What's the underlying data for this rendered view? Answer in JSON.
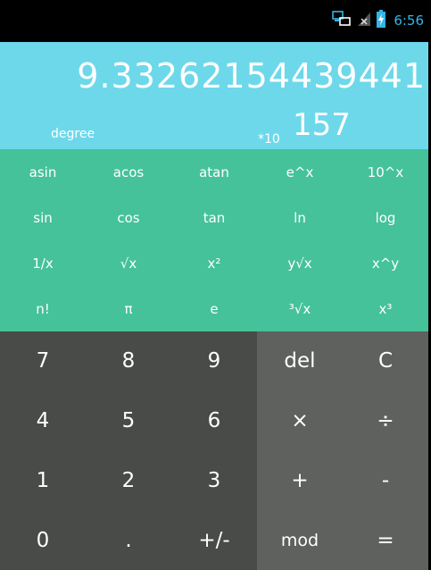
{
  "status_bar": {
    "time": "6:56",
    "icons": [
      "network-icon",
      "signal-icon",
      "battery-charging-icon"
    ],
    "accent_color": "#33b5e5"
  },
  "display": {
    "value": "9.33262154439441",
    "mode": "degree",
    "exponent_base": "*10",
    "exponent": "157",
    "background": "#6dd8ea"
  },
  "scientific_keys": [
    [
      "asin",
      "acos",
      "atan",
      "e^x",
      "10^x"
    ],
    [
      "sin",
      "cos",
      "tan",
      "ln",
      "log"
    ],
    [
      "1/x",
      "√x",
      "x²",
      "y√x",
      "x^y"
    ],
    [
      "n!",
      "π",
      "e",
      "³√x",
      "x³"
    ]
  ],
  "number_keys": [
    [
      "7",
      "8",
      "9"
    ],
    [
      "4",
      "5",
      "6"
    ],
    [
      "1",
      "2",
      "3"
    ],
    [
      "0",
      ".",
      "+/-"
    ]
  ],
  "operator_keys": [
    [
      "del",
      "C"
    ],
    [
      "×",
      "÷"
    ],
    [
      "+",
      "-"
    ],
    [
      "mod",
      "="
    ]
  ],
  "colors": {
    "scientific_pad": "#45c299",
    "number_pad": "#484b48",
    "operator_pad": "#5e615e"
  }
}
